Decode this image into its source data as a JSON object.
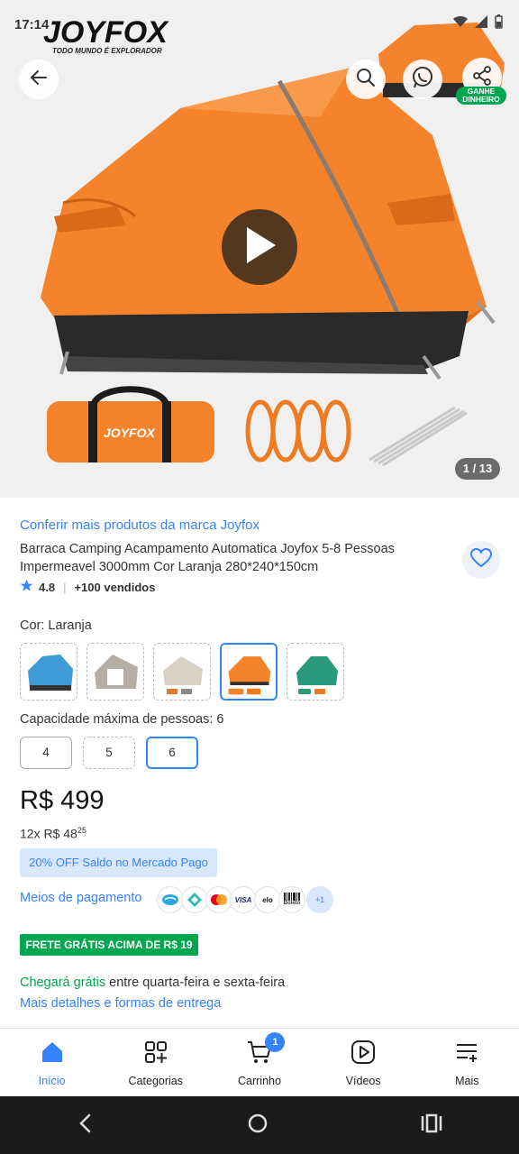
{
  "status_bar": {
    "time": "17:14"
  },
  "brand": {
    "name": "JOYFOX",
    "tagline": "TODO MUNDO É EXPLORADOR"
  },
  "header": {
    "earn_badge": "GANHE DINHEIRO",
    "image_counter": "1 / 13"
  },
  "product": {
    "brand_link": "Conferir mais produtos da marca Joyfox",
    "title": "Barraca Camping Acampamento Automatica Joyfox 5-8 Pessoas Impermeavel 3000mm Cor Laranja 280*240*150cm",
    "rating": "4.8",
    "sold": "+100 vendidos",
    "color_label": "Cor: Laranja",
    "capacity_label": "Capacidade máxima de pessoas: 6",
    "capacity_options": [
      "4",
      "5",
      "6"
    ],
    "price": "R$ 499",
    "installments_prefix": "12x R$ 48",
    "installments_cents": "25",
    "promo": "20% OFF Saldo no Mercado Pago",
    "payment_label": "Meios de pagamento",
    "payment_more": "+1",
    "payment_icons": [
      "visa",
      "elo",
      "boleto"
    ],
    "freight_badge": "FRETE GRÁTIS ACIMA DE R$ 19",
    "delivery_highlight": "Chegará grátis",
    "delivery_rest": " entre quarta-feira e sexta-feira",
    "delivery_link": "Mais detalhes e formas de entrega"
  },
  "nav": {
    "items": [
      {
        "label": "Início"
      },
      {
        "label": "Categorias"
      },
      {
        "label": "Carrinho"
      },
      {
        "label": "Vídeos"
      },
      {
        "label": "Mais"
      }
    ],
    "cart_count": "1"
  },
  "colors": {
    "accent": "#3483fa",
    "green": "#00a650",
    "tent_orange": "#f5822a"
  }
}
